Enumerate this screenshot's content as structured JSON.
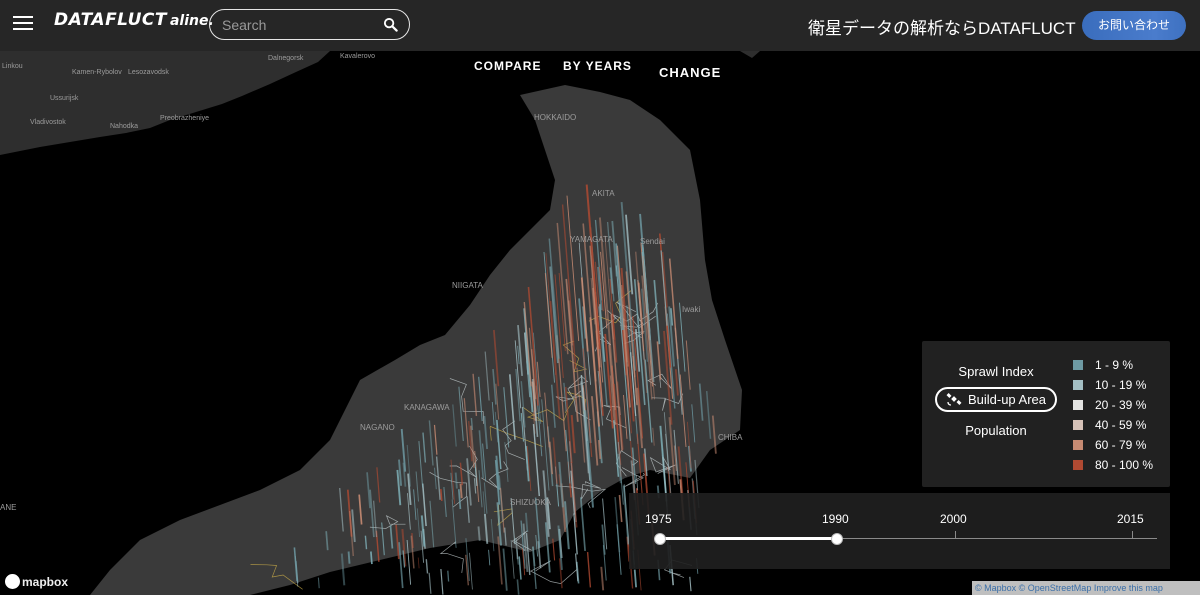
{
  "header": {
    "logo_main": "DATAFLUCT",
    "logo_sub": "aline.",
    "search_placeholder": "Search",
    "tagline": "衛星データの解析ならDATAFLUCT",
    "contact_label": "お問い合わせ"
  },
  "nav": {
    "compare": "COMPARE",
    "by_years": "BY YEARS",
    "change": "CHANGE"
  },
  "legend": {
    "metrics": [
      "Sprawl Index",
      "Build-up Area",
      "Population"
    ],
    "active_metric": "Build-up Area",
    "ranges": [
      {
        "label": "1 - 9 %",
        "color": "#6e9aa3"
      },
      {
        "label": "10 - 19 %",
        "color": "#a4bfc4"
      },
      {
        "label": "20 - 39 %",
        "color": "#e4e4e2"
      },
      {
        "label": "40 - 59 %",
        "color": "#d6c2b8"
      },
      {
        "label": "60 - 79 %",
        "color": "#c78b73"
      },
      {
        "label": "80 - 100 %",
        "color": "#b04a32"
      }
    ]
  },
  "timeline": {
    "years": [
      "1975",
      "1990",
      "2000",
      "2015"
    ],
    "range_start": "1975",
    "range_end": "1990"
  },
  "map": {
    "labels": [
      "Linkou",
      "Kamen-Rybolov",
      "Lesozavodsk",
      "Ussurijsk",
      "Vladivostok",
      "Nahodka",
      "Preobrazheniye",
      "Dalnegorsk",
      "Kavalerovo",
      "NIIGATA",
      "Sendai",
      "Iwaki",
      "CHIBA",
      "KANAGAWA",
      "NAGANO",
      "YAMAGATA",
      "AKITA",
      "HOKKAIDO",
      "SHIZUOKA",
      "ANE"
    ]
  },
  "mapbox_label": "mapbox",
  "attribution": "© Mapbox © OpenStreetMap Improve this map",
  "colors": {
    "header_bg": "#262626",
    "accent": "#3a6dbd"
  }
}
